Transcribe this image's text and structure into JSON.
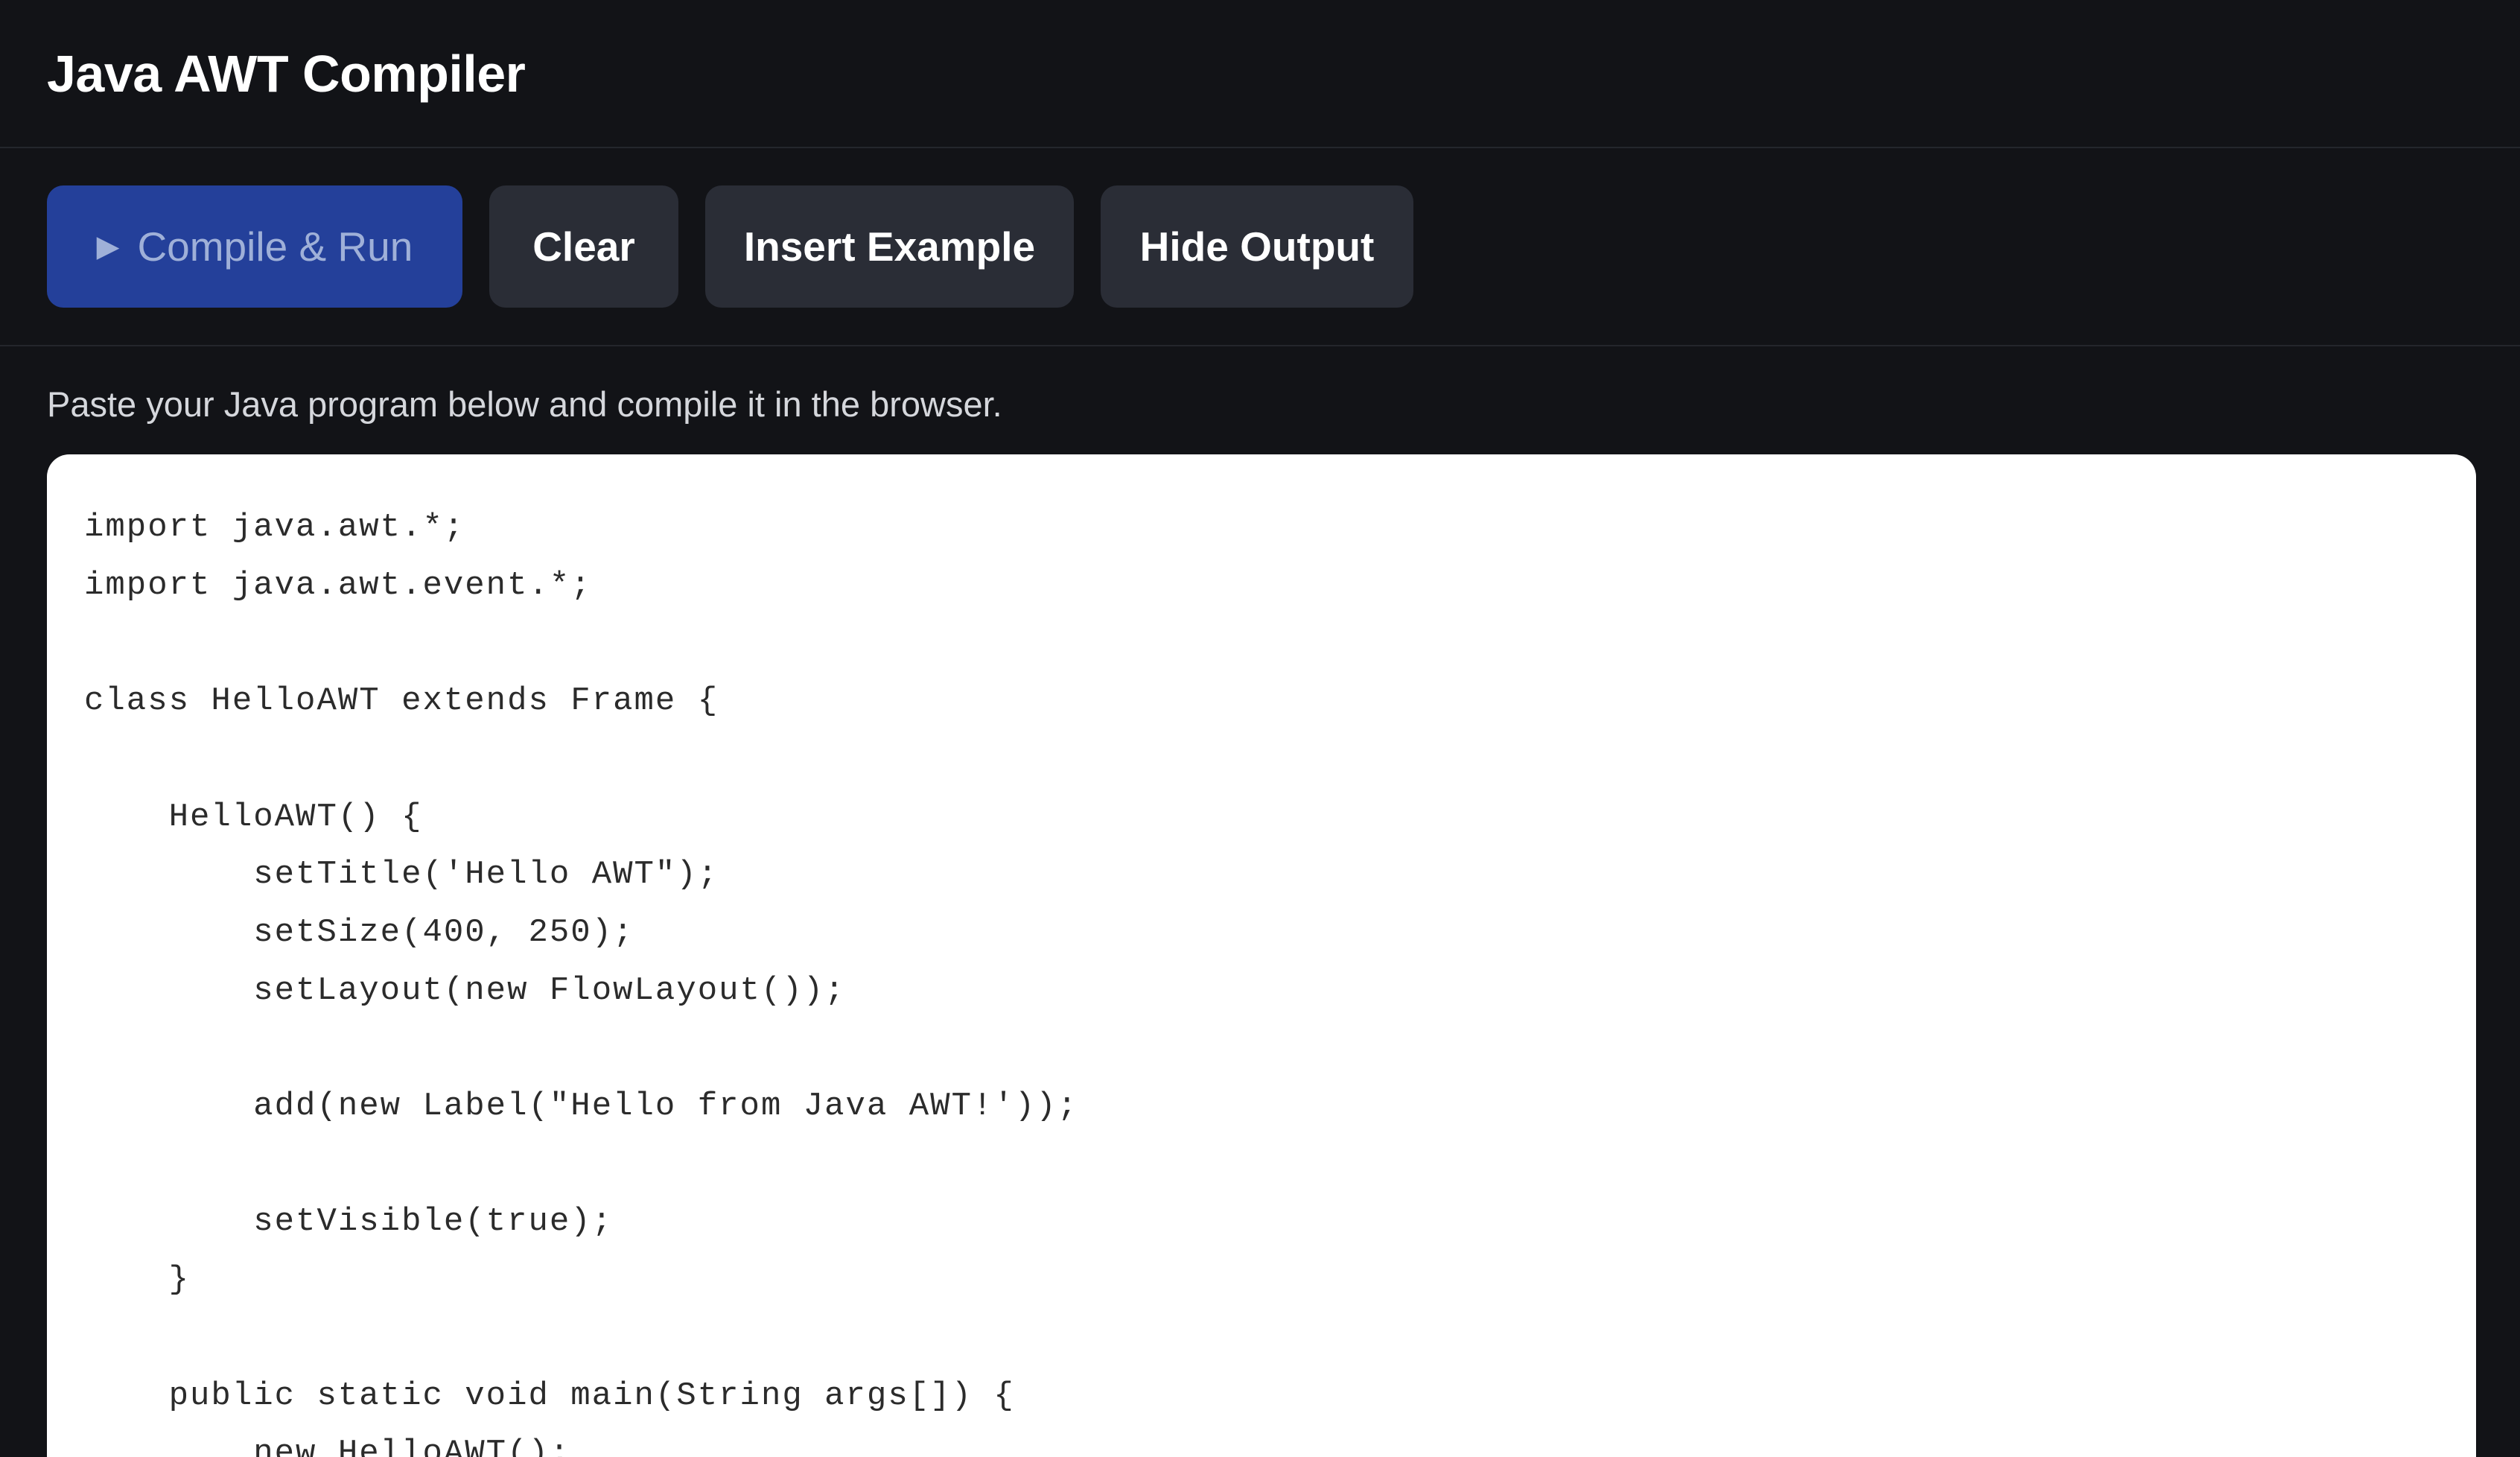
{
  "header": {
    "title": "Java AWT Compiler"
  },
  "toolbar": {
    "run_label": "Compile & Run",
    "run_icon": "play-icon",
    "clear_label": "Clear",
    "example_label": "Insert Example",
    "output_label": "Hide Output"
  },
  "main": {
    "hint": "Paste your Java program below and compile it in the browser.",
    "code": "import java.awt.*;\nimport java.awt.event.*;\n\nclass HelloAWT extends Frame {\n\n    HelloAWT() {\n        setTitle('Hello AWT\");\n        setSize(400, 250);\n        setLayout(new FlowLayout());\n\n        add(new Label(\"Hello from Java AWT!'));\n\n        setVisible(true);\n    }\n\n    public static void main(String args[]) {\n        new HelloAWT();"
  },
  "colors": {
    "background": "#121317",
    "primary_button": "#24409a",
    "secondary_button": "#2a2d36",
    "editor_background": "#ffffff"
  }
}
